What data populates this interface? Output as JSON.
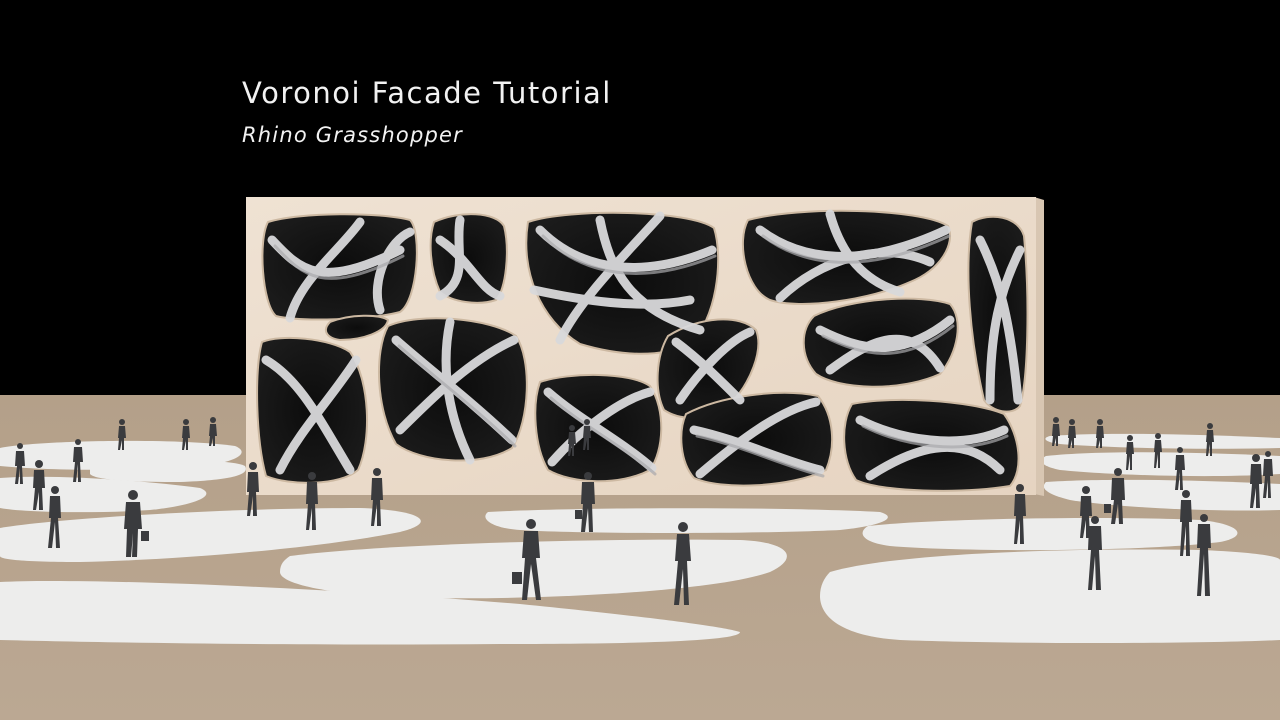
{
  "heading": {
    "title": "Voronoi Facade Tutorial",
    "subtitle": "Rhino Grasshopper"
  },
  "colors": {
    "background": "#000000",
    "ground": "#b9a690",
    "plaza_patches": "#ededec",
    "facade": "#ecdccb",
    "inner_structure": "#d8d8da",
    "figures": "#3a3b3e",
    "text": "#f2f2f2"
  }
}
